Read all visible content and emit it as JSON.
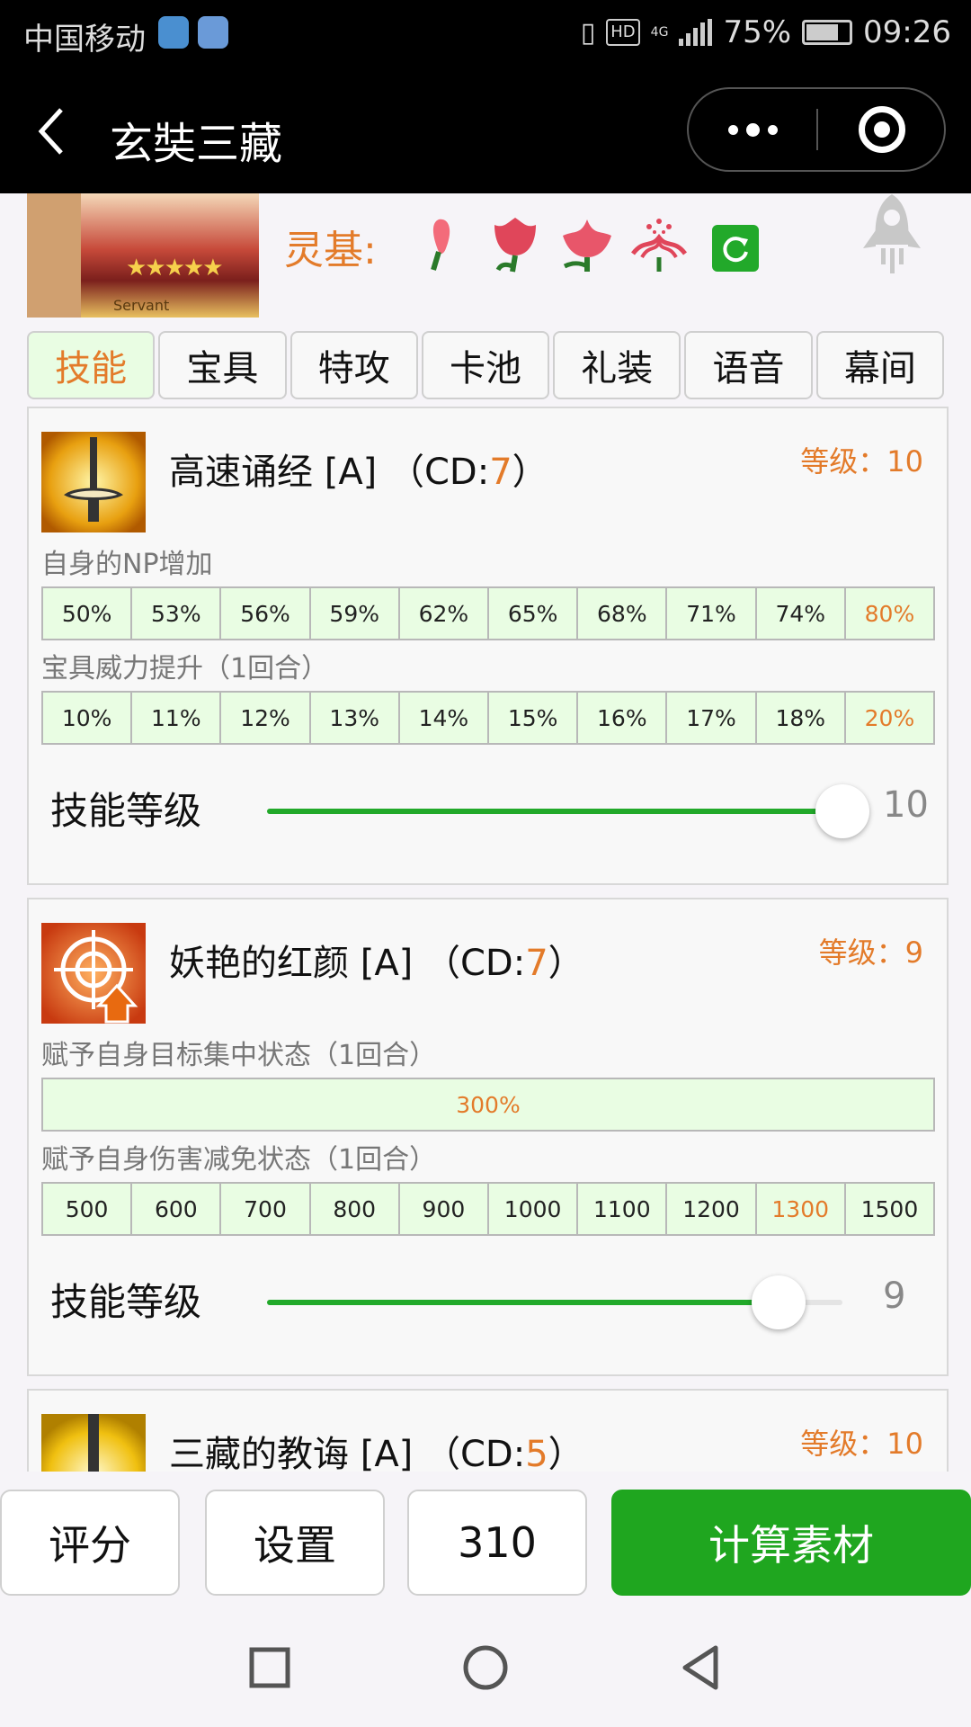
{
  "status_bar": {
    "carrier": "中国移动",
    "hd": "HD",
    "network": "4G",
    "battery": "75%",
    "time": "09:26"
  },
  "nav": {
    "title": "玄奘三藏"
  },
  "header": {
    "lingji_label": "灵基:",
    "portrait_caption": "Servant",
    "stars": "★★★★★"
  },
  "tabs": [
    "技能",
    "宝具",
    "特攻",
    "卡池",
    "礼装",
    "语音",
    "幕间"
  ],
  "active_tab": "技能",
  "skills": [
    {
      "name": "高速诵经 [A] （CD:",
      "cd": "7",
      "name_end": "）",
      "level_text": "等级：10",
      "effects": [
        {
          "label": "自身的NP增加",
          "values": [
            "50%",
            "53%",
            "56%",
            "59%",
            "62%",
            "65%",
            "68%",
            "71%",
            "74%",
            "80%"
          ],
          "highlight_index": 9
        },
        {
          "label": "宝具威力提升（1回合）",
          "values": [
            "10%",
            "11%",
            "12%",
            "13%",
            "14%",
            "15%",
            "16%",
            "17%",
            "18%",
            "20%"
          ],
          "highlight_index": 9
        }
      ],
      "slider_label": "技能等级",
      "slider_value": "10",
      "slider_fraction": 1.0
    },
    {
      "name": "妖艳的红颜 [A] （CD:",
      "cd": "7",
      "name_end": "）",
      "level_text": "等级：9",
      "effects": [
        {
          "label": "赋予自身目标集中状态（1回合）",
          "values": [
            "300%"
          ],
          "highlight_index": 0
        },
        {
          "label": "赋予自身伤害减免状态（1回合）",
          "values": [
            "500",
            "600",
            "700",
            "800",
            "900",
            "1000",
            "1100",
            "1200",
            "1300",
            "1500"
          ],
          "highlight_index": 8
        }
      ],
      "slider_label": "技能等级",
      "slider_value": "9",
      "slider_fraction": 0.889
    },
    {
      "name": "三藏的教诲 [A] （CD:",
      "cd": "5",
      "name_end": "）",
      "level_text": "等级：10"
    }
  ],
  "bottom_bar": {
    "rate": "评分",
    "settings": "设置",
    "count": "310",
    "calc": "计算素材"
  },
  "colors": {
    "accent_orange": "#e37b2a",
    "green": "#22a92a",
    "cell_bg": "#e9fde3"
  }
}
